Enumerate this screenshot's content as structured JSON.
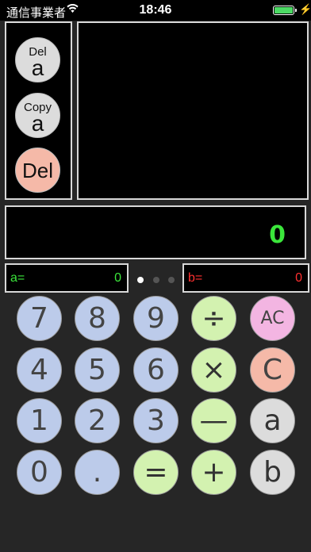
{
  "status_bar": {
    "carrier": "通信事業者",
    "time": "18:46",
    "wifi_icon": "wifi-icon",
    "battery_level": 1.0,
    "battery_color": "#4cd964"
  },
  "side_buttons": {
    "del_a": {
      "top": "Del",
      "bottom": "a"
    },
    "copy_a": {
      "top": "Copy",
      "bottom": "a"
    },
    "del": "Del"
  },
  "display": {
    "value": "0",
    "color": "#3be63b"
  },
  "registers": {
    "a": {
      "label": "a=",
      "value": "0",
      "color": "#3be63b"
    },
    "b": {
      "label": "b=",
      "value": "0",
      "color": "#ff3030"
    }
  },
  "page_indicator": {
    "count": 3,
    "current": 1
  },
  "keypad": {
    "r1": [
      "7",
      "8",
      "9",
      "÷",
      "AC"
    ],
    "r2": [
      "4",
      "5",
      "6",
      "×",
      "C"
    ],
    "r3": [
      "1",
      "2",
      "3",
      "—",
      "a"
    ],
    "r4": [
      "0",
      ".",
      "=",
      "+",
      "b"
    ]
  },
  "colors": {
    "number_key": "#bccbea",
    "operator_key": "#d3f2b0",
    "clear_all_key": "#f3b5e2",
    "clear_key": "#f5b9a8",
    "variable_key": "#dcdcdc"
  }
}
